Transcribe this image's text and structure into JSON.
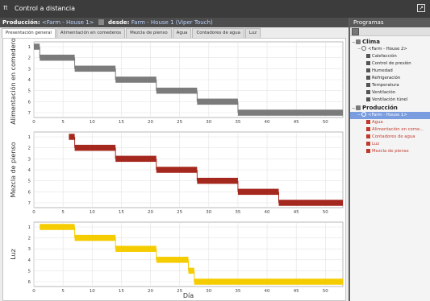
{
  "window": {
    "title": "Control a distancia",
    "app_icon": "π"
  },
  "production_bar": {
    "label_production": "Producción:",
    "production_value": "<Farm - House 1>",
    "label_from": "desde:",
    "from_value": "Farm - House 1 (Viper Touch)"
  },
  "tabs": [
    {
      "label": "Presentación general",
      "active": true
    },
    {
      "label": "Alimentación en comederos",
      "active": false
    },
    {
      "label": "Mezcla de pienso",
      "active": false
    },
    {
      "label": "Agua",
      "active": false
    },
    {
      "label": "Contadores de agua",
      "active": false
    },
    {
      "label": "Luz",
      "active": false
    }
  ],
  "sidebar": {
    "header": "Programas",
    "groups": [
      {
        "label": "Clima",
        "farm": "<Farm - House 2>",
        "items": [
          "Calefacción",
          "Control de presión",
          "Humedad",
          "Refrigeración",
          "Temperatura",
          "Ventilación",
          "Ventilación túnel"
        ]
      },
      {
        "label": "Producción",
        "farm": "<Farm - House 1>",
        "items": [
          "Agua",
          "Alimentación en come...",
          "Contadores de agua",
          "Luz",
          "Mezcla de pienso"
        ]
      }
    ]
  },
  "colors": {
    "alimentacion": "#7b7b7b",
    "mezcla": "#a5281f",
    "luz": "#f5cc00",
    "selected": "#7a9de0",
    "red_text": "#c0392b"
  },
  "chart_data": {
    "type": "step",
    "xlabel": "Día",
    "xlim": [
      0,
      53
    ],
    "xticks": [
      0,
      5,
      10,
      15,
      20,
      25,
      30,
      35,
      40,
      45,
      50
    ],
    "series": [
      {
        "name": "Alimentación en comederos",
        "ylabel": "Alimentación en comederos",
        "yticks": [
          1,
          2,
          3,
          4,
          5,
          6,
          7
        ],
        "segments": [
          {
            "x": [
              0,
              1
            ],
            "y": 1
          },
          {
            "x": [
              1,
              7
            ],
            "y": 2
          },
          {
            "x": [
              7,
              14
            ],
            "y": 3
          },
          {
            "x": [
              14,
              21
            ],
            "y": 4
          },
          {
            "x": [
              21,
              28
            ],
            "y": 5
          },
          {
            "x": [
              28,
              35
            ],
            "y": 6
          },
          {
            "x": [
              35,
              53
            ],
            "y": 7
          }
        ]
      },
      {
        "name": "Mezcla de pienso",
        "ylabel": "Mezcla de pienso",
        "yticks": [
          1,
          2,
          3,
          4,
          5,
          6,
          7
        ],
        "segments": [
          {
            "x": [
              6,
              7
            ],
            "y": 1
          },
          {
            "x": [
              7,
              14
            ],
            "y": 2
          },
          {
            "x": [
              14,
              21
            ],
            "y": 3
          },
          {
            "x": [
              21,
              28
            ],
            "y": 4
          },
          {
            "x": [
              28,
              35
            ],
            "y": 5
          },
          {
            "x": [
              35,
              42
            ],
            "y": 6
          },
          {
            "x": [
              42,
              53
            ],
            "y": 7
          }
        ]
      },
      {
        "name": "Luz",
        "ylabel": "Luz",
        "yticks": [
          1,
          2,
          3,
          4,
          5,
          6
        ],
        "segments": [
          {
            "x": [
              1,
              7
            ],
            "y": 1
          },
          {
            "x": [
              7,
              14
            ],
            "y": 2
          },
          {
            "x": [
              14,
              21
            ],
            "y": 3
          },
          {
            "x": [
              21,
              26.5
            ],
            "y": 4
          },
          {
            "x": [
              26.5,
              27.5
            ],
            "y": 5
          },
          {
            "x": [
              27.5,
              53
            ],
            "y": 6
          }
        ]
      }
    ]
  }
}
